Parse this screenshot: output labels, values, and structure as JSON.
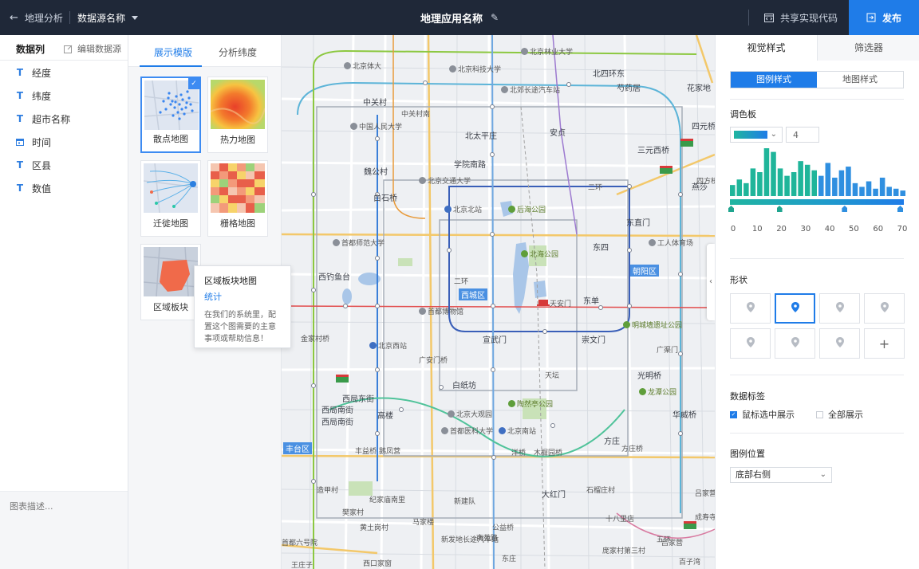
{
  "header": {
    "back_label": "地理分析",
    "datasource_label": "数据源名称",
    "app_title": "地理应用名称",
    "share_label": "共享实现代码",
    "publish_label": "发布"
  },
  "columns": {
    "title": "数据列",
    "edit_label": "编辑数据源",
    "fields": [
      {
        "label": "经度",
        "icon": "text-type-icon"
      },
      {
        "label": "纬度",
        "icon": "text-type-icon"
      },
      {
        "label": "超市名称",
        "icon": "text-type-icon"
      },
      {
        "label": "时间",
        "icon": "date-type-icon"
      },
      {
        "label": "区县",
        "icon": "text-type-icon"
      },
      {
        "label": "数值",
        "icon": "text-type-icon"
      }
    ],
    "description_placeholder": "图表描述..."
  },
  "templates": {
    "tabs": [
      "展示模版",
      "分析纬度"
    ],
    "active_tab": 0,
    "cards": [
      {
        "label": "散点地图",
        "selected": true
      },
      {
        "label": "热力地图",
        "selected": false
      },
      {
        "label": "迁徙地图",
        "selected": false
      },
      {
        "label": "栅格地图",
        "selected": false
      },
      {
        "label": "区域板块",
        "selected": false
      }
    ],
    "tooltip": {
      "title": "区域板块地图",
      "subtitle": "统计",
      "body": "在我们的系统里，配置这个图需要的主意事项或帮助信息！"
    }
  },
  "map": {
    "labels": {
      "l1": "北京体大",
      "l2": "北京科技大学",
      "l3": "北京林业大学",
      "l4": "北四环东",
      "l5": "芍药居",
      "l6": "北郊长途汽车站",
      "l7": "花家地",
      "l8": "中关村",
      "l9": "中国人民大学",
      "l10": "北太平庄",
      "l11": "安贞",
      "l12": "四元桥",
      "l13": "三元西桥",
      "l14": "学院南路",
      "l15": "魏公村",
      "l16": "北京交通大学",
      "l17": "白石桥",
      "l18": "二环",
      "l19": "燕莎",
      "l20": "北京北站",
      "l21": "后海公园",
      "l22": "东直门",
      "l23": "首都师范大学",
      "l24": "北海公园",
      "l25": "工人体育场",
      "l26": "东四",
      "l27": "西钓鱼台",
      "l28": "朝阳区",
      "l29": "西城区",
      "l30": "首都博物馆",
      "l31": "天安门",
      "l32": "东单",
      "l33": "明城墙遗址公园",
      "l34": "金家村桥",
      "l35": "北京西站",
      "l36": "宣武门",
      "l37": "崇文门",
      "l38": "广安门桥",
      "l39": "光明桥",
      "l40": "白纸坊",
      "l41": "西局东街",
      "l42": "陶然亭公园",
      "l43": "龙潭公园",
      "l44": "西局南街",
      "l45": "高楼",
      "l46": "北京大观园",
      "l47": "华威桥",
      "l48": "西局南街",
      "l49": "首都医科大学",
      "l50": "北京南站",
      "l51": "方庄",
      "l52": "丰台区",
      "l53": "丰益桥",
      "l54": "鹅凤营",
      "l55": "洋桥",
      "l56": "木樨园桥",
      "l57": "方庄桥",
      "l58": "造甲村",
      "l59": "纪家庙南里",
      "l60": "新建队",
      "l61": "大红门",
      "l62": "石榴庄村",
      "l63": "吕家营",
      "l64": "樊家村",
      "l65": "黄土岗村",
      "l66": "马家楼",
      "l67": "公益桥",
      "l68": "十八里店",
      "l69": "新发地长途汽车站",
      "l70": "南苑路",
      "l71": "成寿寺",
      "l72": "庞家村第三村",
      "l73": "首都六号院",
      "l74": "东庄",
      "l75": "西口家窗",
      "l76": "王庄子",
      "l77": "四方桥",
      "l78": "吕家营",
      "l79": "百子湾",
      "l80": "二环",
      "l81": "五环",
      "l82": "天坛",
      "l83": "中关村南",
      "l84": "广渠门"
    }
  },
  "style_panel": {
    "tabs": [
      "视觉样式",
      "筛选器"
    ],
    "active_tab": 0,
    "subtabs": [
      "图例样式",
      "地图样式"
    ],
    "active_subtab": 0,
    "palette_title": "调色板",
    "palette_colors": [
      "#1fb5a0",
      "#1f7ce8"
    ],
    "color_count": "4",
    "histogram": [
      12,
      18,
      14,
      30,
      26,
      52,
      48,
      30,
      22,
      26,
      38,
      34,
      28,
      22,
      36,
      20,
      28,
      32,
      14,
      10,
      16,
      8,
      20,
      10,
      8,
      6
    ],
    "range_ticks": [
      "0",
      "10",
      "20",
      "30",
      "40",
      "50",
      "60",
      "70"
    ],
    "range_handles": [
      0,
      20,
      47,
      70
    ],
    "shape_title": "形状",
    "shapes": [
      "pin-icon",
      "pin-icon",
      "pin-icon",
      "pin-icon",
      "pin-icon",
      "pin-icon",
      "pin-icon",
      "plus-icon"
    ],
    "active_shape": 1,
    "label_title": "数据标签",
    "label_opts": [
      {
        "label": "鼠标选中展示",
        "checked": true
      },
      {
        "label": "全部展示",
        "checked": false
      }
    ],
    "legend_pos_title": "图例位置",
    "legend_pos_value": "底部右侧"
  }
}
